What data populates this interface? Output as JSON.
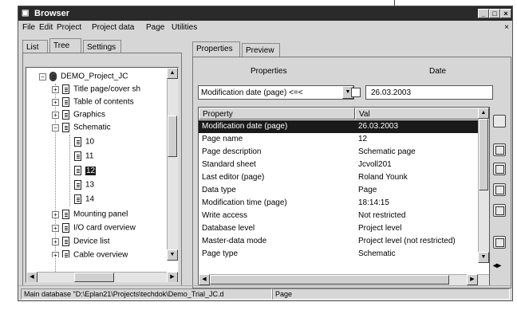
{
  "window": {
    "title": "Browser",
    "app_icon": "eplan-icon"
  },
  "menu": [
    "File",
    "Edit",
    "Project",
    "Project data",
    "Page",
    "Utilities"
  ],
  "left_tabs": [
    "List",
    "Tree",
    "Settings"
  ],
  "tree": [
    {
      "label": "DEMO_Project_JC",
      "expander": "−"
    },
    {
      "label": "Title page/cover sh",
      "expander": "+"
    },
    {
      "label": "Table of contents",
      "expander": "+"
    },
    {
      "label": "Graphics",
      "expander": "+"
    },
    {
      "label": "Schematic",
      "expander": "−"
    },
    {
      "label": "10"
    },
    {
      "label": "11"
    },
    {
      "label": "12",
      "selected": true
    },
    {
      "label": "13"
    },
    {
      "label": "14"
    },
    {
      "label": "Mounting panel",
      "expander": "+"
    },
    {
      "label": "I/O card overview",
      "expander": "+"
    },
    {
      "label": "Device list",
      "expander": "+"
    },
    {
      "label": "Cable overview",
      "expander": "+"
    }
  ],
  "right_tabs": [
    "Properties",
    "Preview"
  ],
  "properties_header": "Properties",
  "date_header": "Date",
  "filter": {
    "field": "Modification date (page) <=<",
    "date": "26.03.2003"
  },
  "grid": {
    "columns": [
      "Property",
      "Val"
    ],
    "rows": [
      [
        "Modification date (page)",
        "26.03.2003"
      ],
      [
        "Page name",
        "12"
      ],
      [
        "Page description",
        "Schematic page"
      ],
      [
        "Standard sheet",
        "Jcvoll201"
      ],
      [
        "Last editor (page)",
        "Roland Younk"
      ],
      [
        "Data type",
        "Page"
      ],
      [
        "Modification time (page)",
        "18:14:15"
      ],
      [
        "Write access",
        "Not restricted"
      ],
      [
        "Database level",
        "Project level"
      ],
      [
        "Master-data mode",
        "Project level (not restricted)"
      ],
      [
        "Page type",
        "Schematic"
      ]
    ]
  },
  "toolbar_icons": [
    "save-icon",
    "blank-icon",
    "edit-icon",
    "copy-icon",
    "paste-icon",
    "print-icon",
    "back-icon"
  ],
  "status": {
    "database": "Main database \"D:\\Eplan21\\Projects\\techdok\\Demo_Trial_JC.d",
    "mode": "Page"
  }
}
